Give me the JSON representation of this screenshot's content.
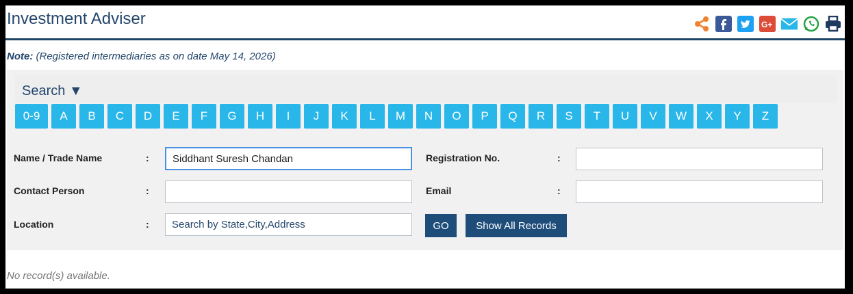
{
  "header": {
    "title": "Investment Adviser",
    "share_icons": [
      "share-icon",
      "facebook-icon",
      "twitter-icon",
      "googleplus-icon",
      "email-icon",
      "whatsapp-icon",
      "print-icon"
    ]
  },
  "note": {
    "label": "Note:",
    "text": " (Registered intermediaries as on date May 14, 2026)"
  },
  "search": {
    "label": "Search ▼",
    "letters": [
      "0-9",
      "A",
      "B",
      "C",
      "D",
      "E",
      "F",
      "G",
      "H",
      "I",
      "J",
      "K",
      "L",
      "M",
      "N",
      "O",
      "P",
      "Q",
      "R",
      "S",
      "T",
      "U",
      "V",
      "W",
      "X",
      "Y",
      "Z"
    ]
  },
  "form": {
    "name_label": "Name / Trade Name",
    "name_value": "Siddhant Suresh Chandan",
    "reg_label": "Registration No.",
    "reg_value": "",
    "contact_label": "Contact Person",
    "contact_value": "",
    "email_label": "Email",
    "email_value": "",
    "location_label": "Location",
    "location_placeholder": "Search by State,City,Address",
    "colon": ":"
  },
  "buttons": {
    "go": "GO",
    "show_all": "Show All Records"
  },
  "status": {
    "no_records": "No record(s) available."
  },
  "colors": {
    "accent": "#29b6e9",
    "navy": "#1e4d7a",
    "title": "#24466c"
  }
}
